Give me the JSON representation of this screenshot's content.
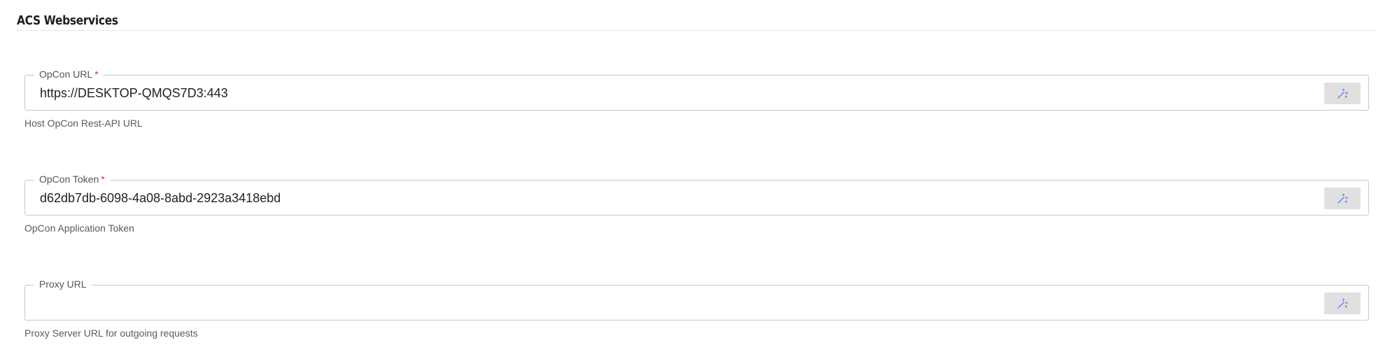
{
  "section": {
    "title": "ACS Webservices"
  },
  "fields": [
    {
      "label": "OpCon URL",
      "required": true,
      "value": "https://DESKTOP-QMQS7D3:443",
      "hint": "Host OpCon Rest-API URL",
      "action_icon": "magic-wand-icon"
    },
    {
      "label": "OpCon Token",
      "required": true,
      "value": "d62db7db-6098-4a08-8abd-2923a3418ebd",
      "hint": "OpCon Application Token",
      "action_icon": "magic-wand-icon"
    },
    {
      "label": "Proxy URL",
      "required": false,
      "value": "",
      "hint": "Proxy Server URL for outgoing requests",
      "action_icon": "magic-wand-icon"
    }
  ],
  "required_marker": "*",
  "colors": {
    "required": "#d32f2f",
    "icon": "#5b8def",
    "button_bg": "#e0e0e0",
    "border": "#c9c9c9"
  }
}
